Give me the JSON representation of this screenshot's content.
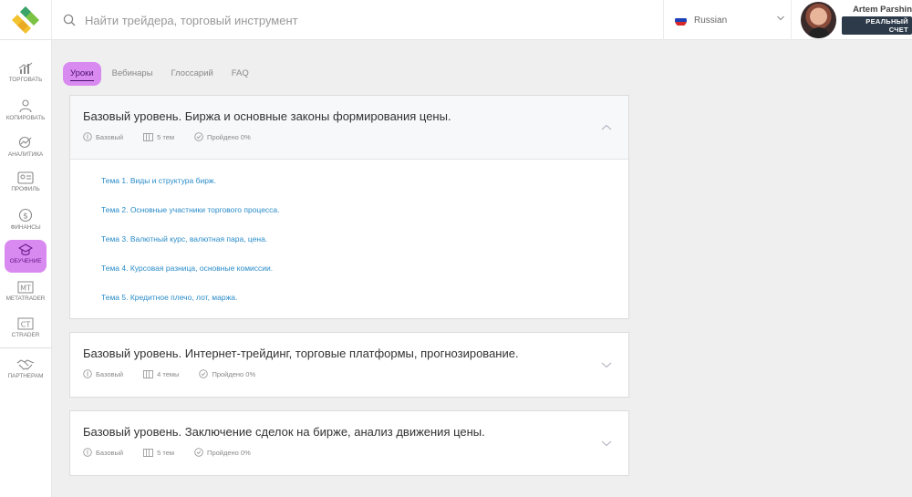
{
  "search": {
    "placeholder": "Найти трейдера, торговый инструмент"
  },
  "language": {
    "selected": "Russian"
  },
  "user": {
    "name": "Artem Parshin",
    "account_badge": "РЕАЛЬНЫЙ СЧЕТ"
  },
  "sidebar": {
    "items": [
      {
        "label": "ТОРГОВАТЬ",
        "icon": "chart-bars-icon"
      },
      {
        "label": "КОПИРОВАТЬ",
        "icon": "users-icon"
      },
      {
        "label": "АНАЛИТИКА",
        "icon": "analytics-icon"
      },
      {
        "label": "ПРОФИЛЬ",
        "icon": "id-card-icon"
      },
      {
        "label": "ФИНАНСЫ",
        "icon": "dollar-icon"
      },
      {
        "label": "ОБУЧЕНИЕ",
        "icon": "graduation-cap-icon",
        "active": true
      },
      {
        "label": "METATRADER",
        "icon": "mt-icon",
        "icon_text": "MT"
      },
      {
        "label": "CTRADER",
        "icon": "ct-icon",
        "icon_text": "CT"
      },
      {
        "label": "ПАРТНЕРАМ",
        "icon": "handshake-icon"
      }
    ]
  },
  "tabs": [
    {
      "label": "Уроки",
      "active": true
    },
    {
      "label": "Вебинары"
    },
    {
      "label": "Глоссарий"
    },
    {
      "label": "FAQ"
    }
  ],
  "courses": [
    {
      "title": "Базовый уровень. Биржа и основные законы формирования цены.",
      "level": "Базовый",
      "topics_count": "5 тем",
      "progress": "Пройдено 0%",
      "expanded": true,
      "topics": [
        "Тема 1. Виды и структура бирж.",
        "Тема 2. Основные участники торгового процесса.",
        "Тема 3. Валютный курс, валютная пара, цена.",
        "Тема 4. Курсовая разница, основные комиссии.",
        "Тема 5. Кредитное плечо, лот, маржа."
      ]
    },
    {
      "title": "Базовый уровень. Интернет-трейдинг, торговые платформы, прогнозирование.",
      "level": "Базовый",
      "topics_count": "4 темы",
      "progress": "Пройдено 0%",
      "expanded": false
    },
    {
      "title": "Базовый уровень. Заключение сделок на бирже, анализ движения цены.",
      "level": "Базовый",
      "topics_count": "5 тем",
      "progress": "Пройдено 0%",
      "expanded": false
    }
  ],
  "colors": {
    "accent": "#d98af0",
    "link": "#2a8cc8",
    "badge_bg": "#2c3a4a",
    "logo_green": "#7cc243",
    "logo_yellow": "#f2c230"
  }
}
